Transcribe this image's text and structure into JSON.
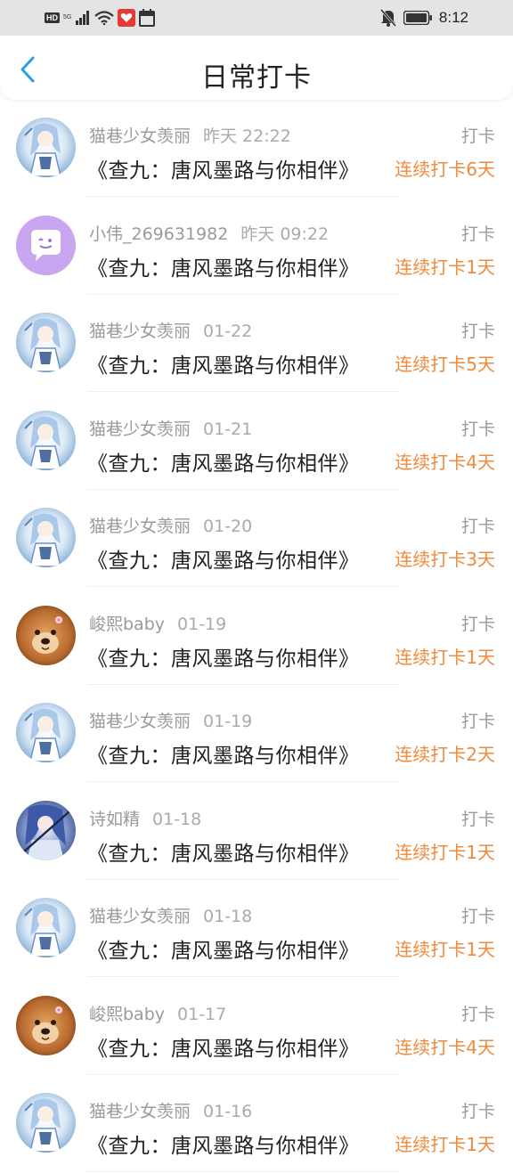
{
  "status_bar": {
    "left_icons": [
      "hd-icon",
      "5g-signal-icon",
      "wifi-icon",
      "app-notify-icon",
      "calendar-icon"
    ],
    "hd_text": "HD",
    "net_text": "5G",
    "right_icons": [
      "bell-muted-icon",
      "battery-icon"
    ],
    "time": "8:12"
  },
  "header": {
    "back_icon": "chevron-left-icon",
    "title": "日常打卡"
  },
  "colors": {
    "accent_blue": "#2a9ee8",
    "streak_orange": "#f08a3c",
    "meta_gray": "#9a9a9a"
  },
  "feed": [
    {
      "user": "猫巷少女羡丽",
      "date": "昨天 22:22",
      "tag": "打卡",
      "title": "《查九：唐风墨路与你相伴》",
      "streak": "连续打卡6天",
      "avatar": "anime-girl"
    },
    {
      "user": "小伟_269631982",
      "date": "昨天 09:22",
      "tag": "打卡",
      "title": "《查九：唐风墨路与你相伴》",
      "streak": "连续打卡1天",
      "avatar": "default-chat"
    },
    {
      "user": "猫巷少女羡丽",
      "date": "01-22",
      "tag": "打卡",
      "title": "《查九：唐风墨路与你相伴》",
      "streak": "连续打卡5天",
      "avatar": "anime-girl"
    },
    {
      "user": "猫巷少女羡丽",
      "date": "01-21",
      "tag": "打卡",
      "title": "《查九：唐风墨路与你相伴》",
      "streak": "连续打卡4天",
      "avatar": "anime-girl"
    },
    {
      "user": "猫巷少女羡丽",
      "date": "01-20",
      "tag": "打卡",
      "title": "《查九：唐风墨路与你相伴》",
      "streak": "连续打卡3天",
      "avatar": "anime-girl"
    },
    {
      "user": "峻熙baby",
      "date": "01-19",
      "tag": "打卡",
      "title": "《查九：唐风墨路与你相伴》",
      "streak": "连续打卡1天",
      "avatar": "dog"
    },
    {
      "user": "猫巷少女羡丽",
      "date": "01-19",
      "tag": "打卡",
      "title": "《查九：唐风墨路与你相伴》",
      "streak": "连续打卡2天",
      "avatar": "anime-girl"
    },
    {
      "user": "诗如精",
      "date": "01-18",
      "tag": "打卡",
      "title": "《查九：唐风墨路与你相伴》",
      "streak": "连续打卡1天",
      "avatar": "anime-blue"
    },
    {
      "user": "猫巷少女羡丽",
      "date": "01-18",
      "tag": "打卡",
      "title": "《查九：唐风墨路与你相伴》",
      "streak": "连续打卡1天",
      "avatar": "anime-girl"
    },
    {
      "user": "峻熙baby",
      "date": "01-17",
      "tag": "打卡",
      "title": "《查九：唐风墨路与你相伴》",
      "streak": "连续打卡4天",
      "avatar": "dog"
    },
    {
      "user": "猫巷少女羡丽",
      "date": "01-16",
      "tag": "打卡",
      "title": "《查九：唐风墨路与你相伴》",
      "streak": "连续打卡1天",
      "avatar": "anime-girl"
    }
  ]
}
